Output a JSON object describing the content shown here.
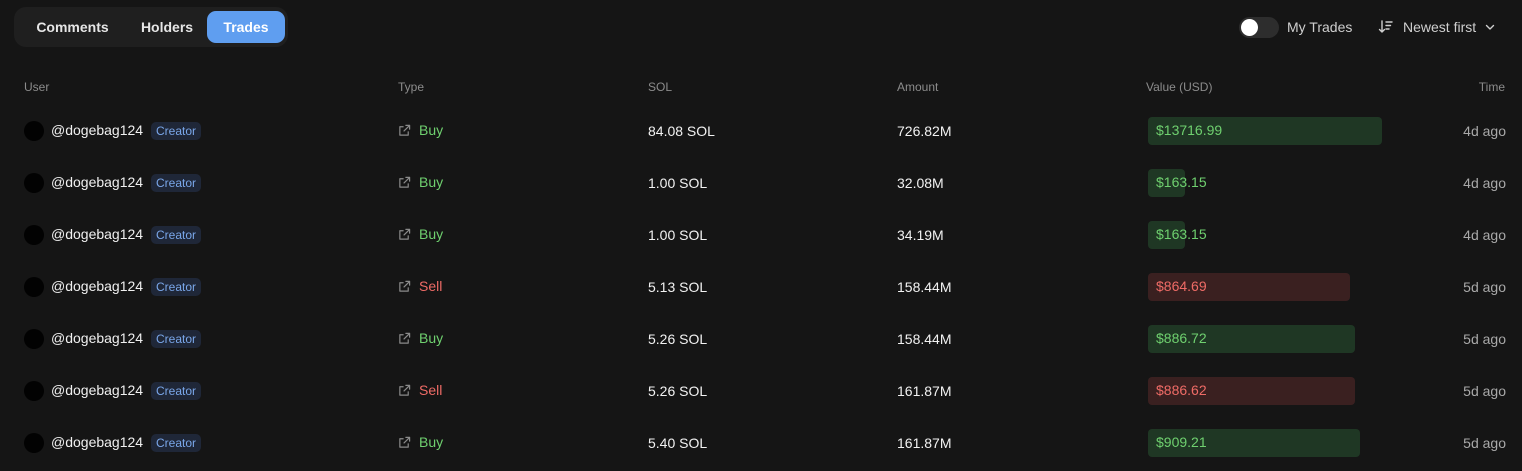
{
  "tabs": [
    {
      "label": "Comments",
      "active": false
    },
    {
      "label": "Holders",
      "active": false
    },
    {
      "label": "Trades",
      "active": true
    }
  ],
  "filters": {
    "my_trades_label": "My Trades",
    "my_trades_enabled": false,
    "sort_label": "Newest first"
  },
  "table": {
    "columns": [
      "User",
      "Type",
      "SOL",
      "Amount",
      "Value (USD)",
      "Time"
    ],
    "rows": [
      {
        "user": "@dogebag124",
        "badge": "Creator",
        "type": "Buy",
        "sol": "84.08 SOL",
        "amount": "726.82M",
        "value": "$13716.99",
        "value_fill": 1.0,
        "time": "4d ago"
      },
      {
        "user": "@dogebag124",
        "badge": "Creator",
        "type": "Buy",
        "sol": "1.00 SOL",
        "amount": "32.08M",
        "value": "$163.15",
        "value_fill": 0.16,
        "time": "4d ago"
      },
      {
        "user": "@dogebag124",
        "badge": "Creator",
        "type": "Buy",
        "sol": "1.00 SOL",
        "amount": "34.19M",
        "value": "$163.15",
        "value_fill": 0.16,
        "time": "4d ago"
      },
      {
        "user": "@dogebag124",
        "badge": "Creator",
        "type": "Sell",
        "sol": "5.13 SOL",
        "amount": "158.44M",
        "value": "$864.69",
        "value_fill": 0.865,
        "time": "5d ago"
      },
      {
        "user": "@dogebag124",
        "badge": "Creator",
        "type": "Buy",
        "sol": "5.26 SOL",
        "amount": "158.44M",
        "value": "$886.72",
        "value_fill": 0.885,
        "time": "5d ago"
      },
      {
        "user": "@dogebag124",
        "badge": "Creator",
        "type": "Sell",
        "sol": "5.26 SOL",
        "amount": "161.87M",
        "value": "$886.62",
        "value_fill": 0.885,
        "time": "5d ago"
      },
      {
        "user": "@dogebag124",
        "badge": "Creator",
        "type": "Buy",
        "sol": "5.40 SOL",
        "amount": "161.87M",
        "value": "$909.21",
        "value_fill": 0.907,
        "time": "5d ago"
      }
    ]
  },
  "colors": {
    "background": "#151515",
    "accent": "#5f9ef0",
    "buy": "#6fd06f",
    "sell": "#ef6b66",
    "buy_bar": "#1f3724",
    "sell_bar": "#3a2020",
    "badge_text": "#7aa7ea"
  },
  "icons": {
    "type_link": "external-link-icon",
    "sort": "sort-descending-icon",
    "dropdown": "chevron-down-icon"
  }
}
